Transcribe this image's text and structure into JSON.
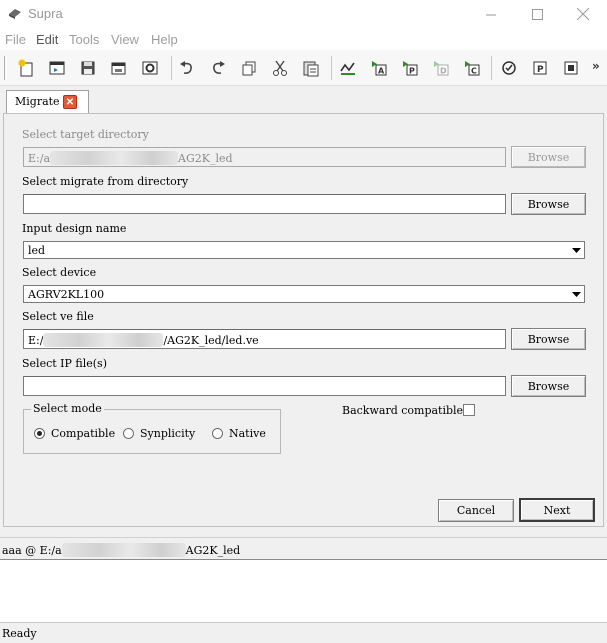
{
  "window": {
    "title": "Supra"
  },
  "menu": {
    "items": [
      "File",
      "Edit",
      "Tools",
      "View",
      "Help"
    ]
  },
  "colors": {
    "tab_close": "#e25a3a",
    "toolbar_green": "#2e8b2e",
    "title_text": "#999999"
  },
  "toolbar": {
    "icons": [
      "new-project-icon",
      "open-project-icon",
      "save-icon",
      "save-as-icon",
      "settings-icon",
      "undo-icon",
      "redo-icon",
      "copy-icon",
      "cut-icon",
      "paste-icon",
      "synthesis-icon",
      "run-a-icon",
      "run-p-icon",
      "run-d-icon",
      "run-c-icon",
      "check-icon",
      "program-icon",
      "chip-icon"
    ],
    "more_label": "»"
  },
  "tab": {
    "label": "Migrate"
  },
  "form": {
    "target_dir": {
      "label": "Select target directory",
      "value_prefix": "E:/a",
      "value_suffix": "AG2K_led",
      "browse": "Browse"
    },
    "migrate_from": {
      "label": "Select migrate from directory",
      "value": "",
      "browse": "Browse"
    },
    "design_name": {
      "label": "Input design name",
      "value": "led"
    },
    "device": {
      "label": "Select device",
      "value": "AGRV2KL100"
    },
    "ve_file": {
      "label": "Select ve file",
      "value_prefix": "E:/",
      "value_suffix": "/AG2K_led/led.ve",
      "browse": "Browse"
    },
    "ip_files": {
      "label": "Select IP file(s)",
      "value": "",
      "browse": "Browse"
    },
    "mode": {
      "legend": "Select mode",
      "options": [
        "Compatible",
        "Synplicity",
        "Native"
      ],
      "selected": "Compatible"
    },
    "backward_compatible": {
      "label": "Backward compatible",
      "checked": false
    },
    "cancel": "Cancel",
    "next": "Next"
  },
  "console": {
    "path_prefix": "aaa @ E:/a",
    "path_suffix": "AG2K_led"
  },
  "status": {
    "text": "Ready"
  }
}
